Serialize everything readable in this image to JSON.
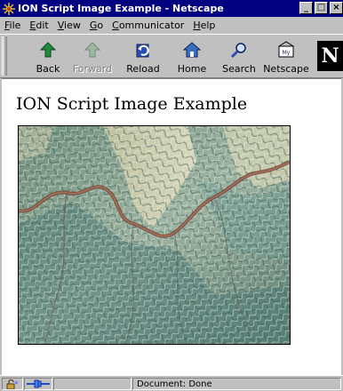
{
  "window": {
    "title": "ION Script Image Example - Netscape",
    "controls": {
      "minimize": "_",
      "maximize": "□",
      "close": "×"
    }
  },
  "menu": {
    "items": [
      {
        "pre": "",
        "key": "F",
        "post": "ile"
      },
      {
        "pre": "",
        "key": "E",
        "post": "dit"
      },
      {
        "pre": "",
        "key": "V",
        "post": "iew"
      },
      {
        "pre": "",
        "key": "G",
        "post": "o"
      },
      {
        "pre": "",
        "key": "C",
        "post": "ommunicator"
      },
      {
        "pre": "",
        "key": "H",
        "post": "elp"
      }
    ]
  },
  "toolbar": {
    "buttons": [
      {
        "label": "Back",
        "icon": "back-arrow-icon",
        "enabled": true
      },
      {
        "label": "Forward",
        "icon": "forward-arrow-icon",
        "enabled": false
      },
      {
        "label": "Reload",
        "icon": "reload-icon",
        "enabled": true
      },
      {
        "label": "Home",
        "icon": "home-icon",
        "enabled": true
      },
      {
        "label": "Search",
        "icon": "search-icon",
        "enabled": true
      },
      {
        "label": "Netscape",
        "icon": "my-netscape-icon",
        "enabled": true
      }
    ],
    "logo_letter": "N"
  },
  "page": {
    "heading": "ION Script Image Example",
    "image_subject": "aerial terrain photograph"
  },
  "status": {
    "text": "Document: Done"
  }
}
